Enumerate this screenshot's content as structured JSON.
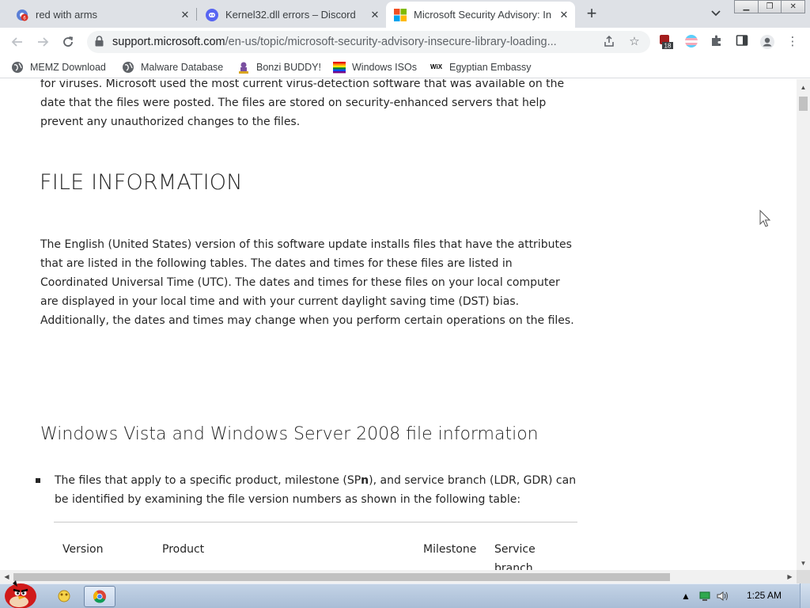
{
  "browser": {
    "tabs": [
      {
        "title": "red with arms",
        "favicon": "chrome-badge-icon",
        "active": false
      },
      {
        "title": "Kernel32.dll errors – Discord",
        "favicon": "discord-icon",
        "active": false
      },
      {
        "title": "Microsoft Security Advisory: In",
        "favicon": "microsoft-logo-icon",
        "active": true
      }
    ],
    "new_tab_label": "+",
    "address_bar": {
      "domain": "support.microsoft.com",
      "path": "/en-us/topic/microsoft-security-advisory-insecure-library-loading..."
    },
    "extension_badge": "18",
    "bookmarks": [
      {
        "label": "MEMZ Download",
        "icon": "globe-icon"
      },
      {
        "label": "Malware Database",
        "icon": "globe-icon"
      },
      {
        "label": "Bonzi BUDDY!",
        "icon": "bonzi-icon"
      },
      {
        "label": "Windows ISOs",
        "icon": "rainbow-flag-icon"
      },
      {
        "label": "Egyptian Embassy",
        "icon": "wix-icon"
      }
    ]
  },
  "article": {
    "intro_lines": [
      "for viruses. Microsoft used the most current virus-detection software that was available on the",
      "date that the files were posted. The files are stored on security-enhanced servers that help",
      "prevent any unauthorized changes to the files."
    ],
    "file_info_heading": "FILE INFORMATION",
    "file_info_lines": [
      "The English (United States) version of this software update installs files that have the attributes",
      "that are listed in the following tables. The dates and times for these files are listed in",
      "Coordinated Universal Time (UTC). The dates and times for these files on your local computer",
      "are displayed in your local time and with your current daylight saving time (DST) bias.",
      "Additionally, the dates and times may change when you perform certain operations on the files."
    ],
    "vista_heading": "Windows Vista and Windows Server 2008 file information",
    "bullet_text_pre": "The files that apply to a specific product, milestone (SP",
    "bullet_text_bold": "n",
    "bullet_text_post": "), and service branch (LDR, GDR) can",
    "bullet_text_line2": "be identified by examining the file version numbers as shown in the following table:",
    "table_headers": [
      "Version",
      "Product",
      "Milestone",
      "Service branch"
    ]
  },
  "taskbar": {
    "clock": "1:25 AM"
  }
}
